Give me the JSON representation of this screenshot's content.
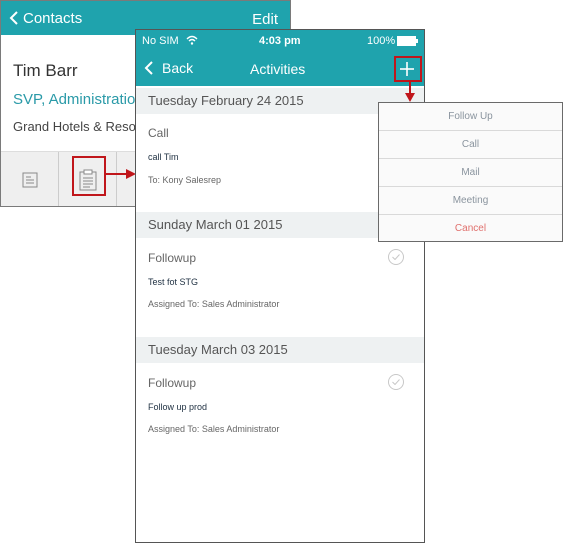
{
  "contact": {
    "back_label": "Contacts",
    "edit_label": "Edit",
    "name": "Tim Barr",
    "title": "SVP, Administration",
    "company": "Grand Hotels & Resorts"
  },
  "status_bar": {
    "carrier": "No SIM",
    "time": "4:03 pm",
    "battery": "100%"
  },
  "activities": {
    "back_label": "Back",
    "title": "Activities",
    "sections": [
      {
        "date": "Tuesday February 24 2015",
        "type": "Call",
        "title": "call Tim",
        "subtitle": "To: Kony Salesrep"
      },
      {
        "date": "Sunday March 01 2015",
        "type": "Followup",
        "title": "Test fot STG",
        "subtitle": "Assigned To: Sales Administrator"
      },
      {
        "date": "Tuesday March 03 2015",
        "type": "Followup",
        "title": "Follow up prod",
        "subtitle": "Assigned To: Sales Administrator"
      }
    ]
  },
  "menu": {
    "items": [
      "Follow Up",
      "Call",
      "Mail",
      "Meeting"
    ],
    "cancel": "Cancel"
  },
  "colors": {
    "header": "#1fa3ad",
    "callout": "#c0161b",
    "cancel": "#e0706d"
  }
}
